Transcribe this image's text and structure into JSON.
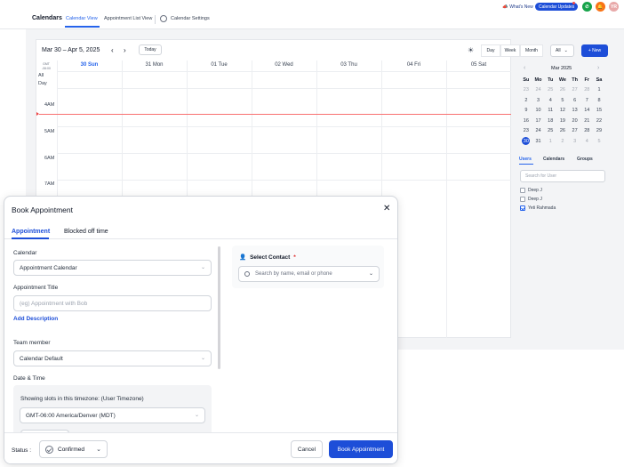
{
  "nav": {
    "brand": "Calendars",
    "tabs": [
      "Calendar View",
      "Appointment List View"
    ],
    "settings": "Calendar Settings",
    "whats_new": "What's New",
    "updates": "Calendar Updates",
    "avatar_initials": "YR",
    "colors": {
      "phone": "#16a34a",
      "bell": "#f97316",
      "avatar": "#e8a9a9"
    }
  },
  "toolbar": {
    "date_range": "Mar 30 – Apr 5, 2025",
    "today": "Today",
    "views": [
      "Day",
      "Week",
      "Month"
    ],
    "filter": "All",
    "new": "+ New"
  },
  "grid": {
    "timezone": "GMT -06:00",
    "all_day": "All Day",
    "days": [
      "30 Sun",
      "31 Mon",
      "01 Tue",
      "02 Wed",
      "03 Thu",
      "04 Fri",
      "05 Sat"
    ],
    "hours": [
      "4AM",
      "5AM",
      "6AM",
      "7AM"
    ]
  },
  "mini_calendar": {
    "title": "Mar 2025",
    "weekdays": [
      "Su",
      "Mo",
      "Tu",
      "We",
      "Th",
      "Fr",
      "Sa"
    ],
    "weeks": [
      [
        "23",
        "24",
        "25",
        "26",
        "27",
        "28",
        "1"
      ],
      [
        "2",
        "3",
        "4",
        "5",
        "6",
        "7",
        "8"
      ],
      [
        "9",
        "10",
        "11",
        "12",
        "13",
        "14",
        "15"
      ],
      [
        "16",
        "17",
        "18",
        "19",
        "20",
        "21",
        "22"
      ],
      [
        "23",
        "24",
        "25",
        "26",
        "27",
        "28",
        "29"
      ],
      [
        "30",
        "31",
        "1",
        "2",
        "3",
        "4",
        "5"
      ]
    ]
  },
  "right_panel": {
    "tabs": [
      "Users",
      "Calendars",
      "Groups"
    ],
    "search_placeholder": "Search for User",
    "users": [
      {
        "name": "Deep J",
        "checked": false
      },
      {
        "name": "Deep J",
        "checked": false
      },
      {
        "name": "Yeti Rahmada",
        "checked": true
      }
    ]
  },
  "modal": {
    "title": "Book Appointment",
    "tabs": [
      "Appointment",
      "Blocked off time"
    ],
    "calendar_label": "Calendar",
    "calendar_value": "Appointment Calendar",
    "title_label": "Appointment Title",
    "title_placeholder": "(eg) Appointment with Bob",
    "add_description": "Add Description",
    "team_label": "Team member",
    "team_value": "Calendar Default",
    "datetime_label": "Date & Time",
    "tz_label": "Showing slots in this timezone: (User Timezone)",
    "tz_value": "GMT-06:00 America/Denver (MDT)",
    "contact_label": "Select Contact",
    "contact_required": "*",
    "contact_placeholder": "Search by name, email or phone",
    "status_label": "Status :",
    "status_value": "Confirmed",
    "cancel": "Cancel",
    "book": "Book Appointment"
  }
}
